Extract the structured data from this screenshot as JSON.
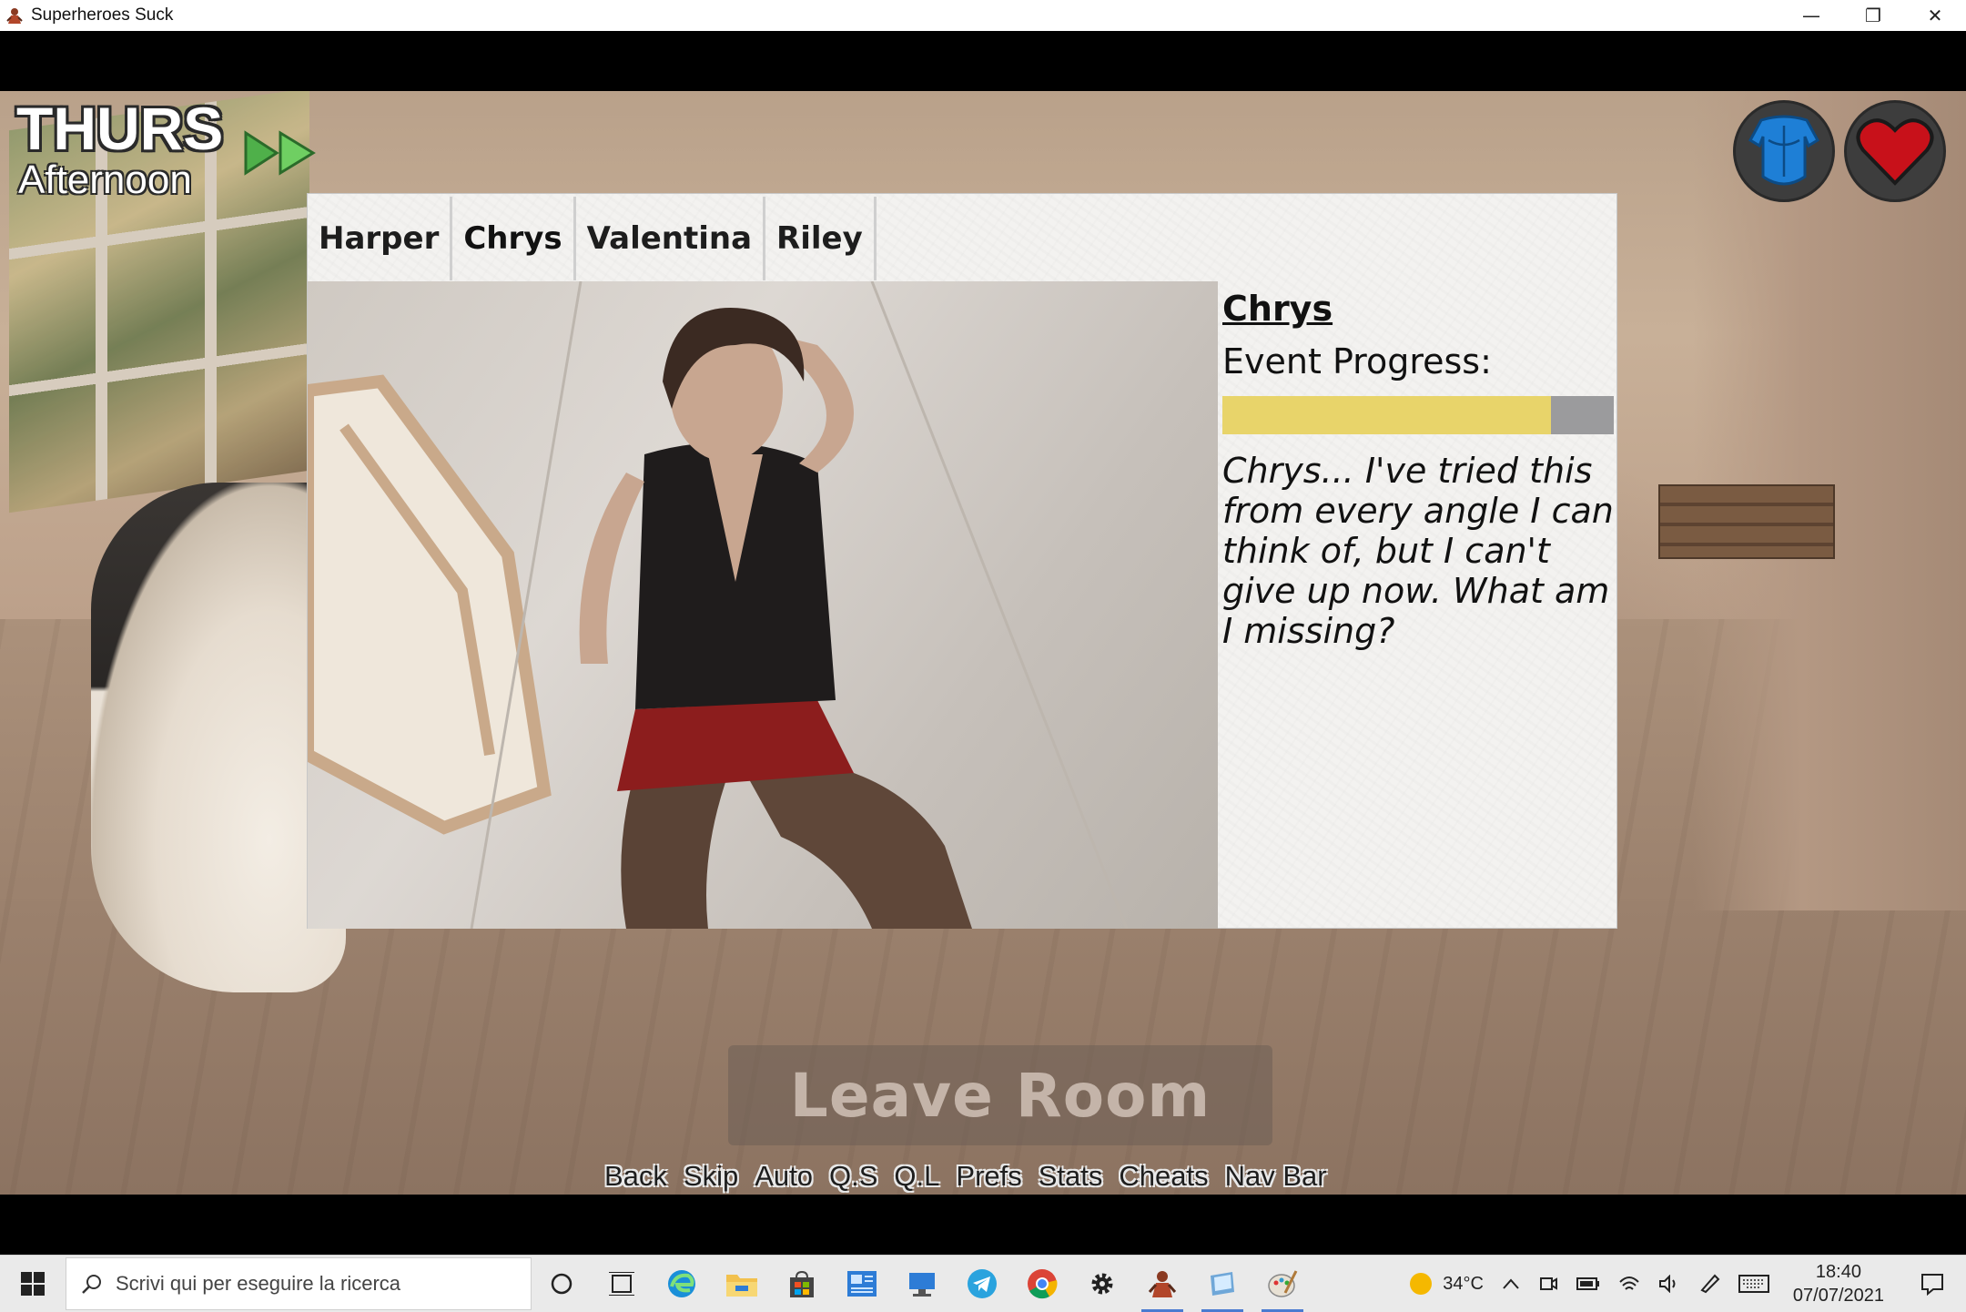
{
  "window": {
    "title": "Superheroes Suck",
    "controls": {
      "minimize": "—",
      "restore": "❐",
      "close": "✕"
    }
  },
  "hud": {
    "day": "THURS",
    "time_of_day": "Afternoon",
    "advance_icon": "double-arrow-icon",
    "stats_icon": "body-icon",
    "relationships_icon": "heart-icon"
  },
  "panel": {
    "tabs": [
      {
        "label": "Harper"
      },
      {
        "label": "Chrys"
      },
      {
        "label": "Valentina"
      },
      {
        "label": "Riley"
      }
    ],
    "active_tab": "Chrys",
    "character_name": "Chrys",
    "event_progress_label": "Event Progress:",
    "event_progress": 0.84,
    "event_text": "Chrys... I've tried this from every angle I can think of, but I can't give up now. What am I missing?"
  },
  "leave_button": "Leave Room",
  "quick_menu": [
    "Back",
    "Skip",
    "Auto",
    "Q.S",
    "Q.L",
    "Prefs",
    "Stats",
    "Cheats",
    "Nav Bar"
  ],
  "taskbar": {
    "search_placeholder": "Scrivi qui per eseguire la ricerca",
    "weather": "34°C",
    "time": "18:40",
    "date": "07/07/2021"
  },
  "colors": {
    "progress_fill": "#e8d46a",
    "progress_empty": "#9b9b9d",
    "stats_icon": "#1e7fd6",
    "heart_icon": "#c8111a"
  }
}
